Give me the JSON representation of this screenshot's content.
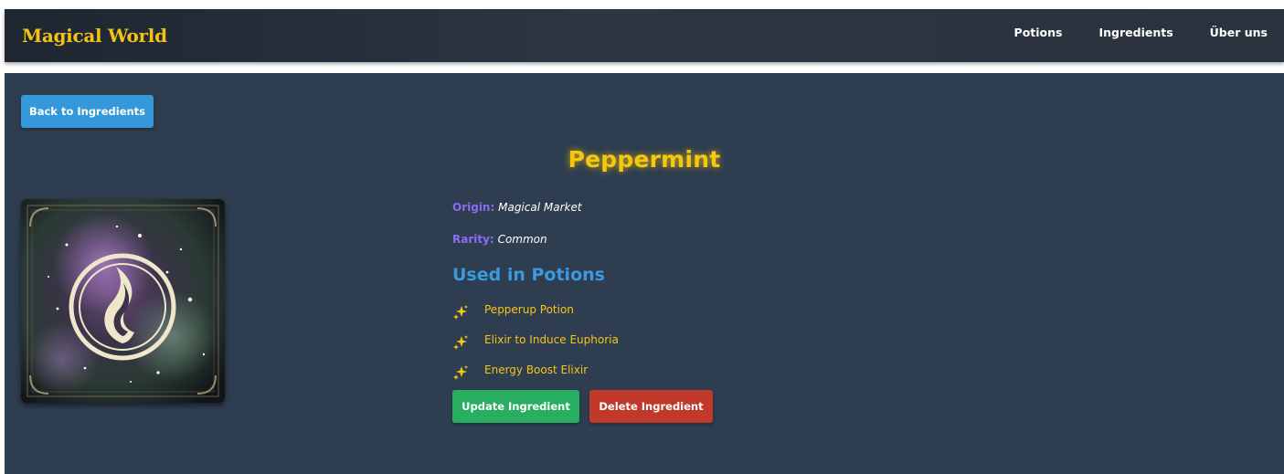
{
  "nav": {
    "brand": "Magical World",
    "links": [
      {
        "label": "Potions"
      },
      {
        "label": "Ingredients"
      },
      {
        "label": "Über uns"
      }
    ]
  },
  "page": {
    "back_label": "Back to Ingredients",
    "title": "Peppermint",
    "origin_label": "Origin:",
    "origin_value": "Magical Market",
    "rarity_label": "Rarity:",
    "rarity_value": "Common",
    "potions_heading": "Used in Potions",
    "potions": [
      {
        "name": "Pepperup Potion",
        "icon": "sparkles-icon"
      },
      {
        "name": "Elixir to Induce Euphoria",
        "icon": "sparkles-icon"
      },
      {
        "name": "Energy Boost Elixir",
        "icon": "sparkles-icon"
      }
    ],
    "update_label": "Update Ingredient",
    "delete_label": "Delete Ingredient"
  },
  "colors": {
    "brand": "#f2c316",
    "background": "#2e3d4f",
    "back_button": "#3498db",
    "update_button": "#27ae60",
    "delete_button": "#c0392b",
    "attribute_label": "#8b6cf0",
    "section_heading": "#3a9ae0",
    "potion_text": "#f5c518"
  }
}
